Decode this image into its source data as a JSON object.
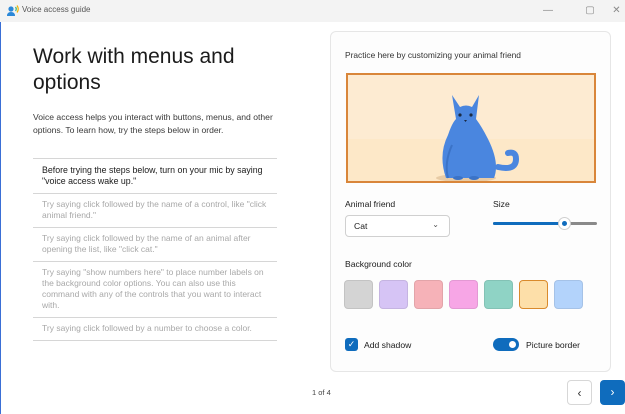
{
  "window": {
    "title": "Voice access guide",
    "controls": {
      "minimize": "—",
      "maximize": "▢",
      "close": "✕"
    }
  },
  "main": {
    "heading": "Work with menus and options",
    "intro": "Voice access helps you interact with buttons, menus, and other options. To learn how, try the steps below in order.",
    "steps": [
      "Before trying the steps below, turn on your mic by saying \"voice access wake up.\"",
      "Try saying click followed by the name of a control, like \"click animal friend.\"",
      "Try saying click followed by the name of an animal after opening the list, like \"click cat.\"",
      "Try saying \"show numbers here\" to place number labels on the background color options. You can also use this command with any of the controls that you want to interact with.",
      "Try saying click followed by a number to choose a color."
    ]
  },
  "practice": {
    "title": "Practice here by customizing your animal friend",
    "animal_friend_label": "Animal friend",
    "animal_value": "Cat",
    "size_label": "Size",
    "size_value": 0.68,
    "background_color_label": "Background color",
    "swatches": [
      "#d4d4d4",
      "#d6c4f5",
      "#f6b2b8",
      "#f7a6e6",
      "#8fd3c5",
      "#fddfa9",
      "#b3d3fb"
    ],
    "selected_swatch_index": 5,
    "add_shadow_label": "Add shadow",
    "add_shadow_checked": true,
    "picture_border_label": "Picture border",
    "picture_border_on": true
  },
  "footer": {
    "page_counter": "1 of 4",
    "prev_icon": "‹",
    "next_icon": "›"
  },
  "colors": {
    "accent": "#0f6cbd",
    "border_frame": "#d9863a",
    "cat": "#4a86df"
  }
}
